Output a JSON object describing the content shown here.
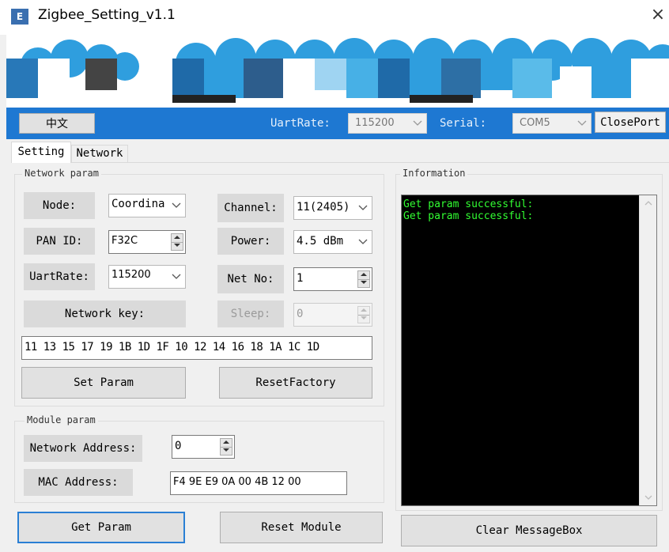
{
  "window": {
    "title": "Zigbee_Setting_v1.1",
    "icon": "app-logo-icon",
    "icon_text": "E",
    "close": "×"
  },
  "toolbar": {
    "lang_button": "中文",
    "uart_label": "UartRate:",
    "uart_value": "115200",
    "serial_label": "Serial:",
    "serial_value": "COM5",
    "close_port_button": "ClosePort",
    "accent_color": "#1e78d2"
  },
  "tabs": [
    {
      "label": "Setting",
      "active": true
    },
    {
      "label": "Network",
      "active": false
    }
  ],
  "network_param": {
    "title": "Network param",
    "node_label": "Node:",
    "node_value": "Coordina",
    "pan_id_label": "PAN ID:",
    "pan_id_value": "F32C",
    "uart_label": "UartRate:",
    "uart_value": "115200",
    "network_key_label": "Network key:",
    "channel_label": "Channel:",
    "channel_value": "11(2405)",
    "power_label": "Power:",
    "power_value": "4.5 dBm",
    "net_no_label": "Net No:",
    "net_no_value": "1",
    "sleep_label": "Sleep:",
    "sleep_value": "0",
    "key_value": "11 13 15 17 19 1B 1D 1F 10 12 14 16 18 1A 1C 1D",
    "set_param_button": "Set Param",
    "reset_factory_button": "ResetFactory"
  },
  "module_param": {
    "title": "Module param",
    "network_address_label": "Network Address:",
    "network_address_value": "0",
    "mac_label": "MAC Address:",
    "mac_value": "F4 9E E9 0A 00 4B 12 00"
  },
  "buttons": {
    "get_param": "Get Param",
    "reset_module": "Reset Module",
    "clear_messagebox": "Clear MessageBox"
  },
  "information": {
    "title": "Information",
    "lines": [
      "Get param successful:",
      "Get param successful:"
    ],
    "text_color": "#32ff32"
  }
}
